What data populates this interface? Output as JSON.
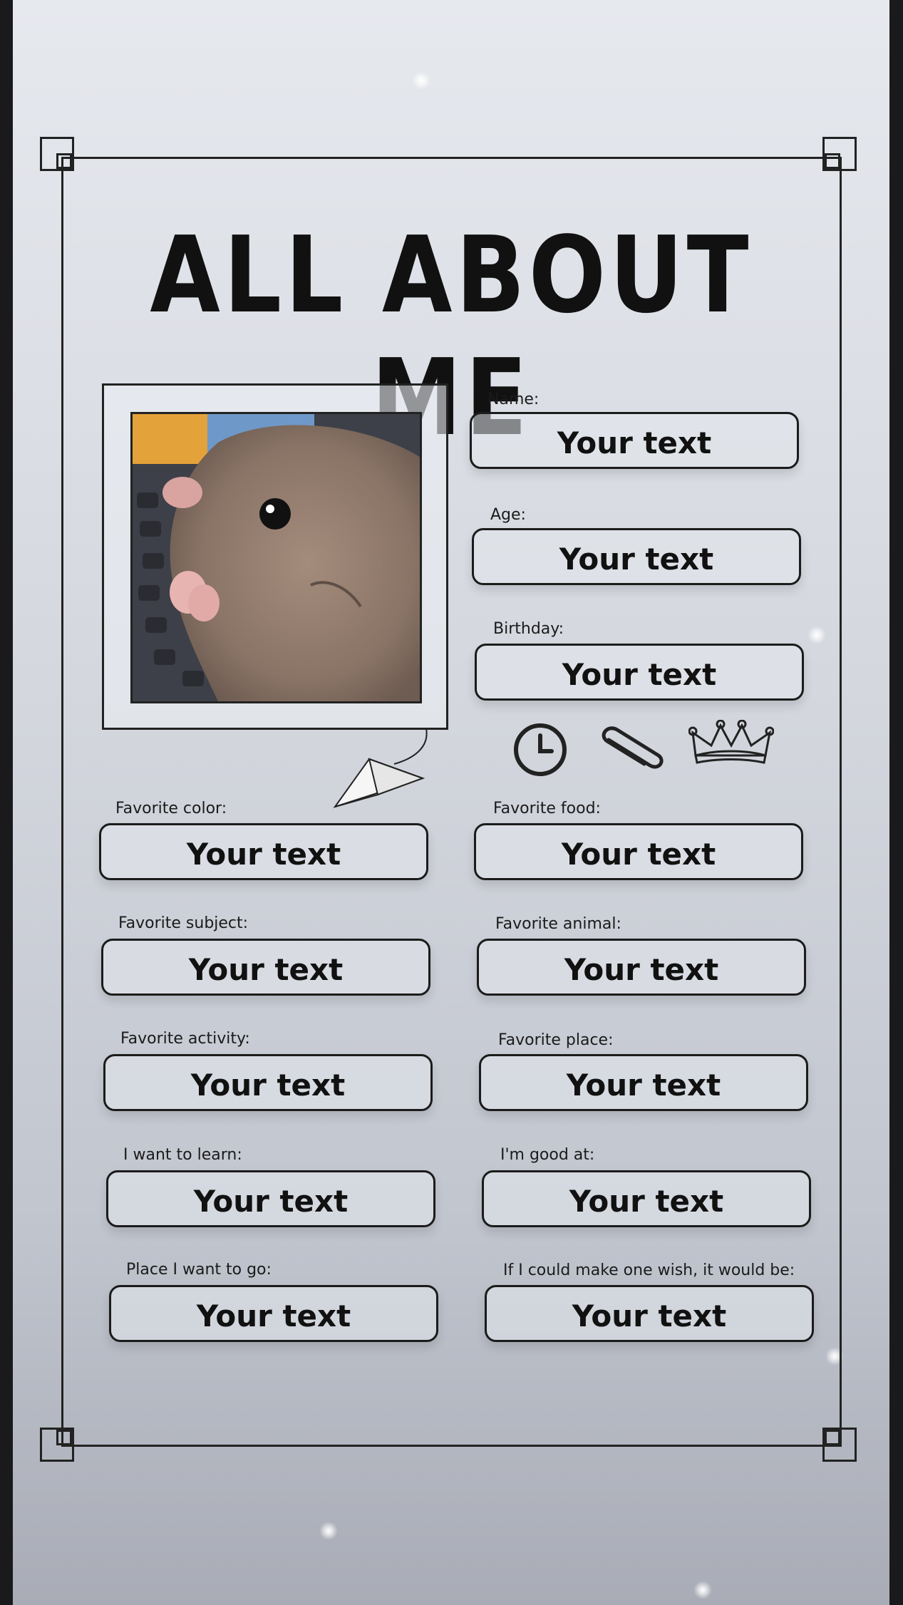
{
  "title": "ALL ABOUT ME",
  "photo": {
    "subject": "hamster-photo"
  },
  "fields": [
    {
      "label": "Name:",
      "value": "Your text"
    },
    {
      "label": "Age:",
      "value": "Your text"
    },
    {
      "label": "Birthday:",
      "value": "Your text"
    },
    {
      "label": "Favorite color:",
      "value": "Your text"
    },
    {
      "label": "Favorite food:",
      "value": "Your text"
    },
    {
      "label": "Favorite subject:",
      "value": "Your text"
    },
    {
      "label": "Favorite animal:",
      "value": "Your text"
    },
    {
      "label": "Favorite activity:",
      "value": "Your text"
    },
    {
      "label": "Favorite place:",
      "value": "Your text"
    },
    {
      "label": "I want to learn:",
      "value": "Your text"
    },
    {
      "label": "I'm good at:",
      "value": "Your text"
    },
    {
      "label": "Place I want to go:",
      "value": "Your text"
    },
    {
      "label": "If I could make one wish, it would be:",
      "value": "Your text"
    }
  ],
  "icons": [
    "clock-icon",
    "paperclip-icon",
    "crown-icon",
    "paper-plane-icon"
  ],
  "colors": {
    "ink": "#1b1b1b",
    "background_top": "#e6e9ee",
    "background_bottom": "#a9acb6"
  }
}
